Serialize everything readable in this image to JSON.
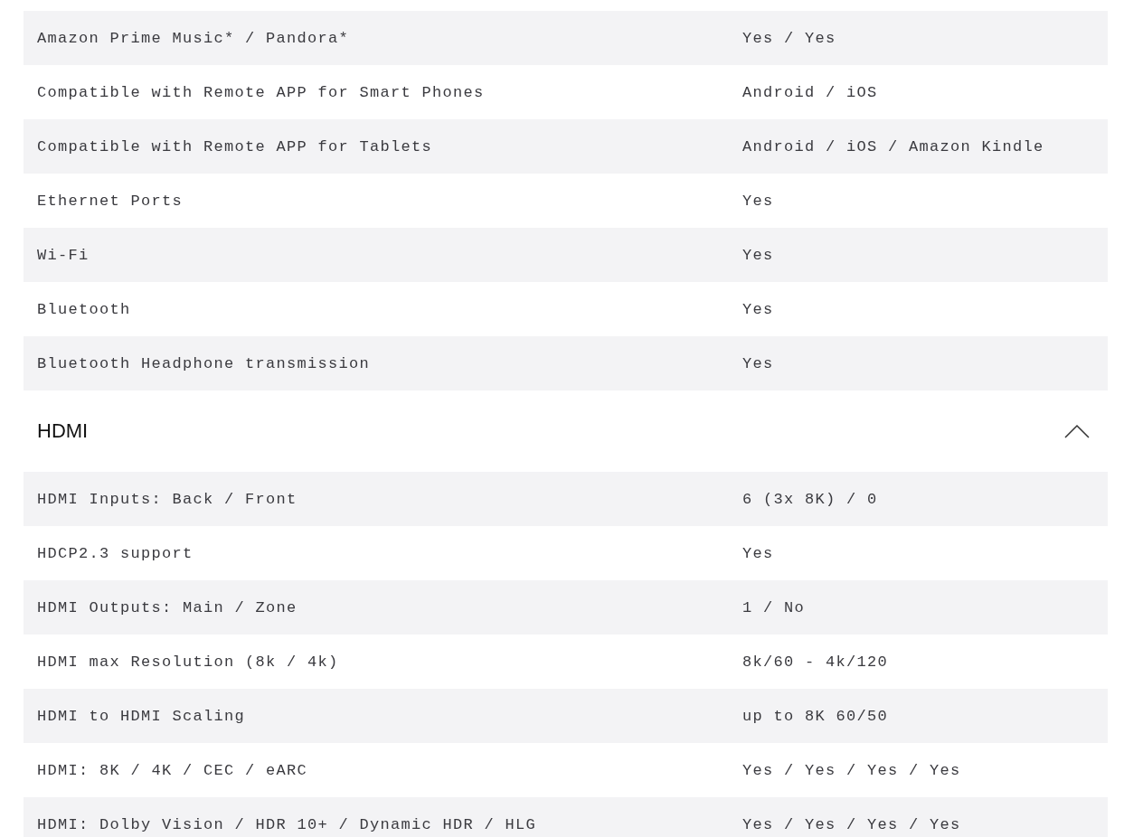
{
  "spec_rows": [
    {
      "label": "Amazon Prime Music* / Pandora*",
      "value": "Yes / Yes"
    },
    {
      "label": "Compatible with Remote APP for Smart Phones",
      "value": "Android / iOS"
    },
    {
      "label": "Compatible with Remote APP for Tablets",
      "value": "Android / iOS / Amazon Kindle"
    },
    {
      "label": "Ethernet Ports",
      "value": "Yes"
    },
    {
      "label": "Wi-Fi",
      "value": "Yes"
    },
    {
      "label": "Bluetooth",
      "value": "Yes"
    },
    {
      "label": "Bluetooth Headphone transmission",
      "value": "Yes"
    }
  ],
  "hdmi_section": {
    "title": "HDMI",
    "expanded": true,
    "rows": [
      {
        "label": "HDMI Inputs: Back / Front",
        "value": "6 (3x 8K) / 0"
      },
      {
        "label": "HDCP2.3 support",
        "value": "Yes"
      },
      {
        "label": "HDMI Outputs: Main / Zone",
        "value": "1 / No"
      },
      {
        "label": "HDMI max Resolution (8k / 4k)",
        "value": "8k/60 - 4k/120"
      },
      {
        "label": "HDMI to HDMI Scaling",
        "value": "up to 8K 60/50"
      },
      {
        "label": "HDMI: 8K / 4K / CEC / eARC",
        "value": "Yes / Yes / Yes / Yes"
      },
      {
        "label": "HDMI: Dolby Vision / HDR 10+ / Dynamic HDR / HLG",
        "value": "Yes / Yes / Yes / Yes"
      }
    ]
  }
}
